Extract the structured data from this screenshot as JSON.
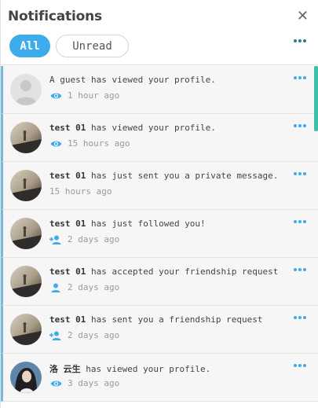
{
  "header": {
    "title": "Notifications",
    "close_glyph": "✕",
    "tabs": [
      {
        "label": "All",
        "active": true
      },
      {
        "label": "Unread",
        "active": false
      }
    ]
  },
  "colors": {
    "accent": "#3eacea",
    "item_bg": "#f6f6f6",
    "scrollbar": "#3cc0a8"
  },
  "notifications": [
    {
      "actor": "",
      "message": "A guest has viewed your profile.",
      "time": "1 hour ago",
      "icon": "eye-icon",
      "avatar": "guest"
    },
    {
      "actor": "test 01",
      "message": " has viewed your profile.",
      "time": "15 hours ago",
      "icon": "eye-icon",
      "avatar": "photo"
    },
    {
      "actor": "test 01",
      "message": " has just sent you a private message.",
      "time": "15 hours ago",
      "icon": "",
      "avatar": "photo"
    },
    {
      "actor": "test 01",
      "message": " has just followed you!",
      "time": "2 days ago",
      "icon": "user-plus-icon",
      "avatar": "photo"
    },
    {
      "actor": "test 01",
      "message": " has accepted your friendship request",
      "time": "2 days ago",
      "icon": "user-icon",
      "avatar": "photo"
    },
    {
      "actor": "test 01",
      "message": " has sent you a friendship request",
      "time": "2 days ago",
      "icon": "user-plus-icon",
      "avatar": "photo"
    },
    {
      "actor": "洛 云生",
      "message": " has viewed your profile.",
      "time": "3 days ago",
      "icon": "eye-icon",
      "avatar": "person"
    }
  ]
}
